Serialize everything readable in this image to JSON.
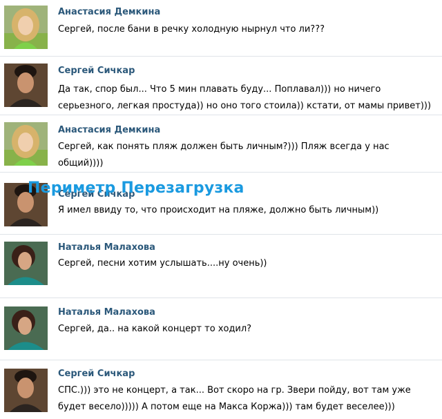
{
  "comments": [
    {
      "author": "Анастасия Демкина",
      "text": "Сергей, после бани в речку холодную нырнул что ли???"
    },
    {
      "author": "Сергей Сичкар",
      "text": "Да так, спор был... Что 5 мин плавать буду... Поплавал))) но ничего серьезного, легкая простуда)) но оно того стоила)) кстати, от мамы привет)))"
    },
    {
      "author": "Анастасия Демкина",
      "text": "Сергей, как понять пляж должен быть личным?))) Пляж всегда у нас общий))))"
    },
    {
      "author": "Сергей Сичкар",
      "text": "Я имел ввиду то, что происходит на пляже, должно быть личным))"
    },
    {
      "author": "Наталья Малахова",
      "text": "Сергей, песни хотим услышать....ну очень))"
    },
    {
      "author": "Наталья Малахова",
      "text": "Сергей, да.. на какой концерт то ходил?"
    },
    {
      "author": "Сергей Сичкар",
      "text": "СПС.))) это не концерт, а так... Вот скоро на гр. Звери пойду, вот там уже будет весело))))) А потом еще на Макса Коржа))) там будет веселее)))"
    }
  ],
  "watermark": "Периметр Перезагрузка",
  "colors": {
    "author": "#2b587a",
    "divider": "#dfe3e8",
    "watermark": "#1a9ae0"
  }
}
